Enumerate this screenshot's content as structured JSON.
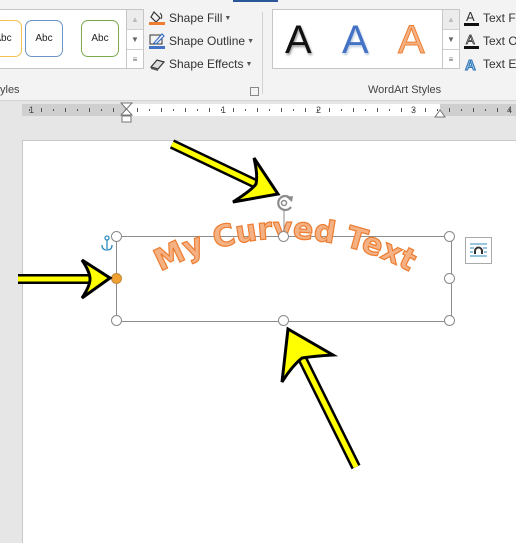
{
  "ribbon": {
    "shape_styles": {
      "group_label": "Shape Styles",
      "group_label_visible": "yles",
      "presets": [
        {
          "label": "Abc",
          "border_color": "#f2c14e"
        },
        {
          "label": "Abc",
          "border_color": "#6d93c4"
        },
        {
          "label": "Abc",
          "border_color": "#7dab4e"
        }
      ],
      "commands": [
        {
          "label": "Shape Fill",
          "icon": "paint-bucket-icon",
          "accent": "#ed7d31"
        },
        {
          "label": "Shape Outline",
          "icon": "pencil-icon",
          "accent": "#4472c4"
        },
        {
          "label": "Shape Effects",
          "icon": "eraser-icon"
        }
      ]
    },
    "wordart_styles": {
      "group_label": "WordArt Styles",
      "presets": [
        {
          "label": "A",
          "color": "#111111"
        },
        {
          "label": "A",
          "color": "#4472c4"
        },
        {
          "label": "A",
          "color": "#f4b183"
        }
      ],
      "commands": [
        {
          "label": "Text Fill",
          "visible": "Text Fi",
          "icon": "text-fill-icon"
        },
        {
          "label": "Text Outline",
          "visible": "Text O",
          "icon": "text-outline-icon"
        },
        {
          "label": "Text Effects",
          "visible": "Text Ef",
          "icon": "text-effects-icon"
        }
      ]
    }
  },
  "ruler": {
    "numbers": [
      "1",
      "1",
      "2",
      "3",
      "4"
    ]
  },
  "document": {
    "wordart_text": "My Curved Text",
    "wordart_fill": "#f4b183",
    "wordart_outline": "#ed7d31",
    "selected_handle_color": "#f0a030"
  },
  "annotations": {
    "arrow_color": "#ffff00",
    "arrows": [
      "pointing-to-rotation-handle",
      "pointing-to-left-handle",
      "pointing-to-bottom-handle"
    ]
  }
}
